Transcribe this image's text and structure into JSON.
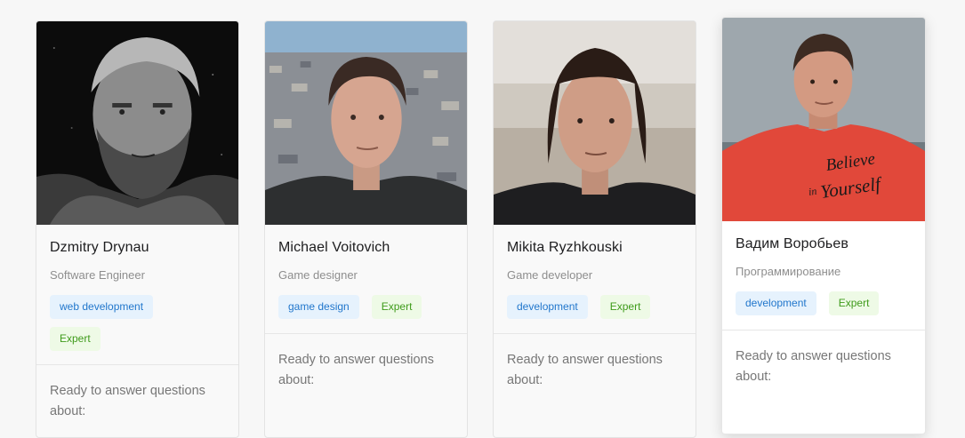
{
  "mentors": [
    {
      "name": "Dzmitry Drynau",
      "role": "Software Engineer",
      "topic_tag": "web development",
      "level_tag": "Expert",
      "about": "Ready to answer questions about:",
      "photo_icon": "portrait-bw-bearded-man"
    },
    {
      "name": "Michael Voitovich",
      "role": "Game designer",
      "topic_tag": "game design",
      "level_tag": "Expert",
      "about": "Ready to answer questions about:",
      "photo_icon": "portrait-city-background"
    },
    {
      "name": "Mikita Ryzhkouski",
      "role": "Game developer",
      "topic_tag": "development",
      "level_tag": "Expert",
      "about": "Ready to answer questions about:",
      "photo_icon": "portrait-long-hair"
    },
    {
      "name": "Вадим Воробьев",
      "role": "Программирование",
      "topic_tag": "development",
      "level_tag": "Expert",
      "about": "Ready to answer questions about:",
      "photo_icon": "portrait-red-shirt",
      "shirt_text": [
        "Believe",
        "in",
        "Yourself"
      ]
    }
  ],
  "colors": {
    "topic_tag_bg": "#e6f2fd",
    "topic_tag_text": "#2277cc",
    "level_tag_bg": "#eefae6",
    "level_tag_text": "#3f9b1b"
  }
}
